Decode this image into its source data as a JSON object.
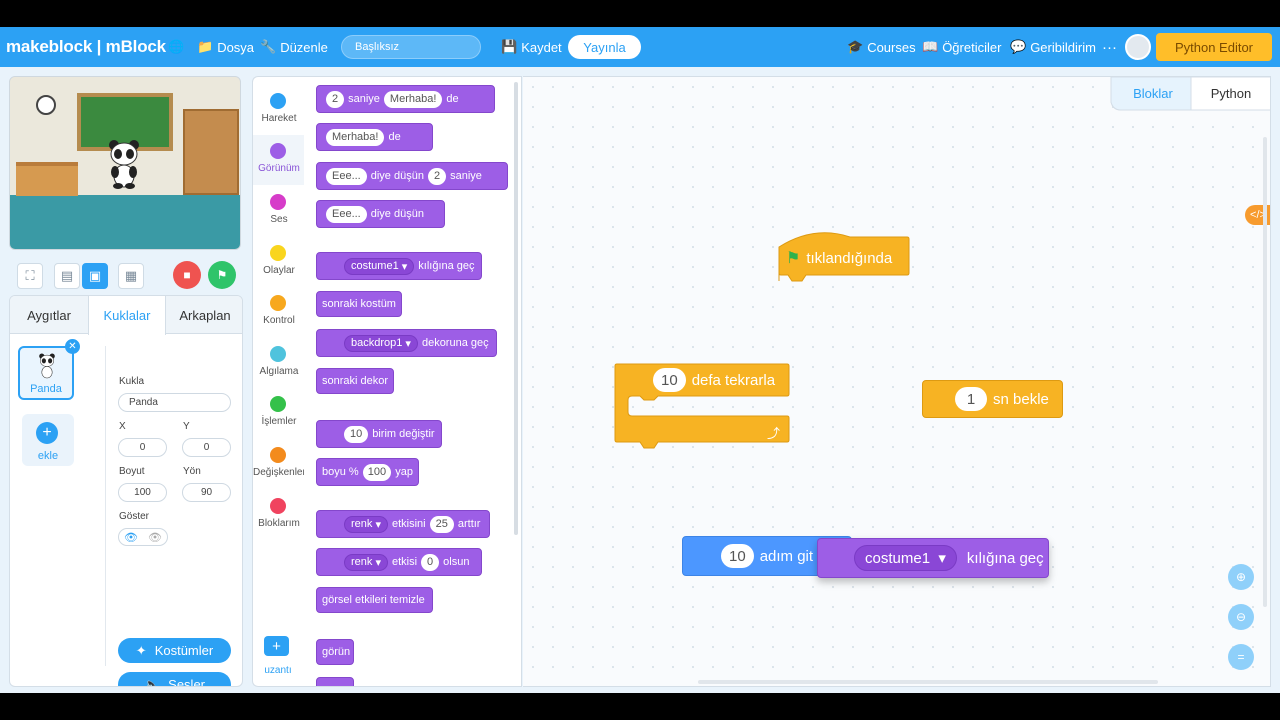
{
  "topbar": {
    "brand": "makeblock | mBlock",
    "file_menu": "Dosya",
    "edit_menu": "Düzenle",
    "project_title": "Başlıksız",
    "save": "Kaydet",
    "publish": "Yayınla",
    "courses": "Courses",
    "tutorials": "Öğreticiler",
    "feedback": "Geribildirim",
    "more": "···",
    "python_editor": "Python Editor"
  },
  "left_tabs": [
    "Aygıtlar",
    "Kuklalar",
    "Arkaplan"
  ],
  "sprite": {
    "name": "Panda",
    "add_label": "ekle",
    "fields": {
      "name_label": "Kukla",
      "name_value": "Panda",
      "x_label": "X",
      "x_value": "0",
      "y_label": "Y",
      "y_value": "0",
      "size_label": "Boyut",
      "size_value": "100",
      "direction_label": "Yön",
      "direction_value": "90",
      "show_label": "Göster"
    },
    "costumes_button": "Kostümler",
    "sounds_button": "Sesler"
  },
  "categories": [
    {
      "label": "Hareket",
      "color": "#2ca1f4"
    },
    {
      "label": "Görünüm",
      "color": "#9d5ee6"
    },
    {
      "label": "Ses",
      "color": "#d63cc9"
    },
    {
      "label": "Olaylar",
      "color": "#f9d51e"
    },
    {
      "label": "Kontrol",
      "color": "#f7a81e"
    },
    {
      "label": "Algılama",
      "color": "#4fc3dd"
    },
    {
      "label": "İşlemler",
      "color": "#34c14a"
    },
    {
      "label": "Değişkenler",
      "color": "#f38b1d"
    },
    {
      "label": "Bloklarım",
      "color": "#f0435f"
    }
  ],
  "extension_label": "uzantı",
  "palette": {
    "say_for": {
      "secs": "2",
      "w1": "saniye",
      "msg": "Merhaba!",
      "w2": "de"
    },
    "say": {
      "msg": "Merhaba!",
      "w": "de"
    },
    "think_for": {
      "msg": "Eee...",
      "w1": "diye düşün",
      "secs": "2",
      "w2": "saniye"
    },
    "think": {
      "msg": "Eee...",
      "w": "diye düşün"
    },
    "switch_costume": {
      "value": "costume1",
      "w": "kılığına geç"
    },
    "next_costume": "sonraki kostüm",
    "switch_backdrop": {
      "value": "backdrop1",
      "w": "dekoruna geç"
    },
    "next_backdrop": "sonraki dekor",
    "change_size": {
      "value": "10",
      "w": "birim değiştir"
    },
    "set_size": {
      "w1": "boyu %",
      "value": "100",
      "w2": "yap"
    },
    "change_effect": {
      "effect": "renk",
      "w1": "etkisini",
      "value": "25",
      "w2": "arttır"
    },
    "set_effect": {
      "effect": "renk",
      "w1": "etkisi",
      "value": "0",
      "w2": "olsun"
    },
    "clear_effects": "görsel etkileri temizle",
    "show": "görün"
  },
  "workspace_tabs": {
    "blocks": "Bloklar",
    "python": "Python"
  },
  "code_badge": "</>",
  "workspace": {
    "flag_hat": "tıklandığında",
    "repeat": {
      "value": "10",
      "label": "defa tekrarla"
    },
    "wait": {
      "value": "1",
      "label": "sn bekle"
    },
    "move": {
      "value": "10",
      "label": "adım git"
    },
    "switch_costume": {
      "value": "costume1",
      "label": "kılığına geç"
    }
  },
  "colors": {
    "accent": "#2ca1f4",
    "looks": "#9d5ee6",
    "control": "#f7b323",
    "motion": "#4c97ff",
    "python_button": "#ffbe29"
  }
}
